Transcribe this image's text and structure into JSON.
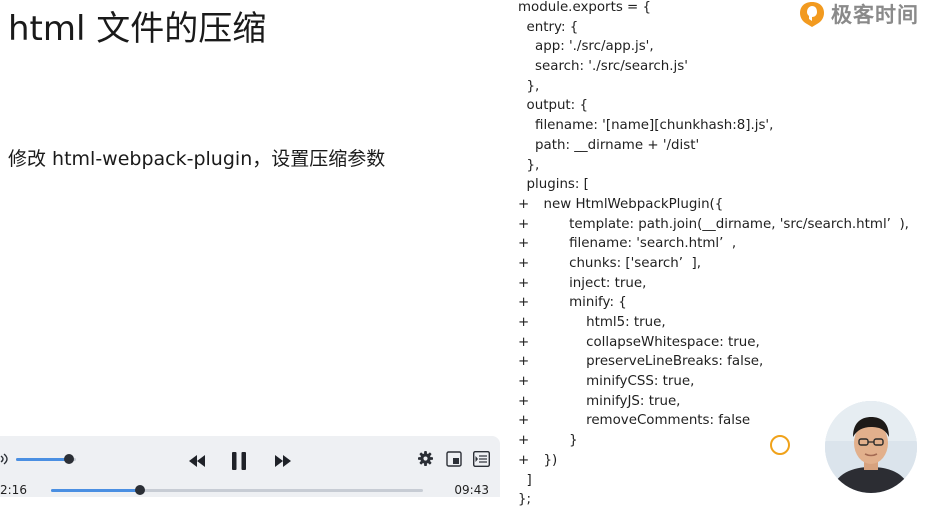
{
  "slide": {
    "title": "html 文件的压缩",
    "bullet": "修改 html-webpack-plugin，设置压缩参数"
  },
  "brand": {
    "name": "极客时间",
    "mark_color": "#f29a1f",
    "text_color": "#8a8a8a"
  },
  "code": {
    "lines": [
      {
        "marker": "",
        "text": "module.exports = {"
      },
      {
        "marker": "",
        "text": "  entry: {"
      },
      {
        "marker": "",
        "text": "    app: './src/app.js',"
      },
      {
        "marker": "",
        "text": "    search: './src/search.js'"
      },
      {
        "marker": "",
        "text": "  },"
      },
      {
        "marker": "",
        "text": "  output: {"
      },
      {
        "marker": "",
        "text": "    filename: '[name][chunkhash:8].js',"
      },
      {
        "marker": "",
        "text": "    path: __dirname + '/dist'"
      },
      {
        "marker": "",
        "text": "  },"
      },
      {
        "marker": "",
        "text": "  plugins: ["
      },
      {
        "marker": "+",
        "text": "      new HtmlWebpackPlugin({"
      },
      {
        "marker": "+",
        "text": "            template: path.join(__dirname, 'src/search.html’  ),"
      },
      {
        "marker": "+",
        "text": "            filename: 'search.html’  ,"
      },
      {
        "marker": "+",
        "text": "            chunks: ['search’  ],"
      },
      {
        "marker": "+",
        "text": "            inject: true,"
      },
      {
        "marker": "+",
        "text": "            minify: {"
      },
      {
        "marker": "+",
        "text": "                html5: true,"
      },
      {
        "marker": "+",
        "text": "                collapseWhitespace: true,"
      },
      {
        "marker": "+",
        "text": "                preserveLineBreaks: false,"
      },
      {
        "marker": "+",
        "text": "                minifyCSS: true,"
      },
      {
        "marker": "+",
        "text": "                minifyJS: true,"
      },
      {
        "marker": "+",
        "text": "                removeComments: false"
      },
      {
        "marker": "+",
        "text": "            }"
      },
      {
        "marker": "+",
        "text": "      })"
      },
      {
        "marker": "",
        "text": "  ]"
      },
      {
        "marker": "",
        "text": "};"
      }
    ]
  },
  "player": {
    "elapsed": "2:16",
    "total": "09:43",
    "progress": 0.24,
    "volume": 0.88,
    "accent_color": "#4a8fe2",
    "icons": [
      "volume-icon",
      "rewind-icon",
      "pause-icon",
      "fast-forward-icon",
      "settings-icon",
      "picture-in-picture-icon",
      "playlist-icon"
    ]
  }
}
